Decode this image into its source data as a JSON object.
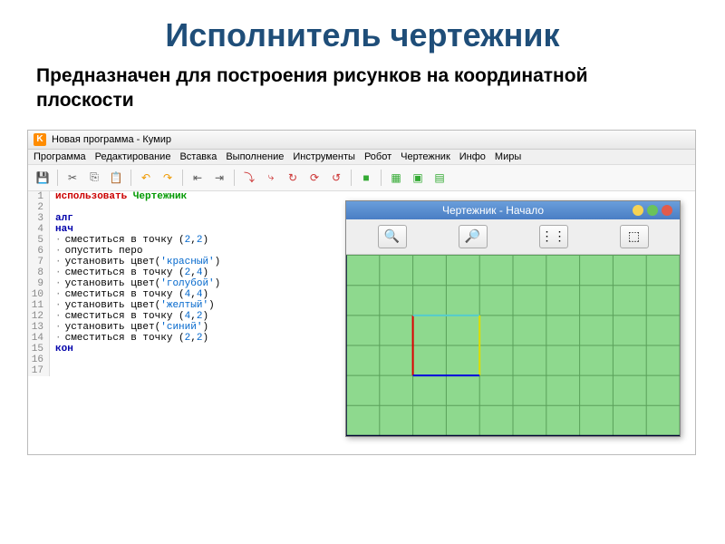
{
  "slide": {
    "title": "Исполнитель чертежник",
    "subtitle": "Предназначен для построения рисунков на координатной плоскости"
  },
  "app": {
    "title": "Новая программа - Кумир",
    "menu": [
      "Программа",
      "Редактирование",
      "Вставка",
      "Выполнение",
      "Инструменты",
      "Робот",
      "Чертежник",
      "Инфо",
      "Миры"
    ]
  },
  "code": {
    "lines": [
      {
        "n": "1",
        "html": "<span class='kw-use'>использовать</span> <span class='kw-module'>Чертежник</span>"
      },
      {
        "n": "2",
        "html": ""
      },
      {
        "n": "3",
        "html": "<span class='kw-alg'>алг</span>"
      },
      {
        "n": "4",
        "html": "<span class='kw-alg'>нач</span>"
      },
      {
        "n": "5",
        "html": "<span class='bullet'>·</span><span class='kw-cmd'>сместиться в точку </span>(<span class='kw-num'>2</span>,<span class='kw-num'>2</span>)"
      },
      {
        "n": "6",
        "html": "<span class='bullet'>·</span><span class='kw-cmd'>опустить перо</span>"
      },
      {
        "n": "7",
        "html": "<span class='bullet'>·</span><span class='kw-cmd'>установить цвет</span>(<span class='kw-str'>'красный'</span>)"
      },
      {
        "n": "8",
        "html": "<span class='bullet'>·</span><span class='kw-cmd'>сместиться в точку </span>(<span class='kw-num'>2</span>,<span class='kw-num'>4</span>)"
      },
      {
        "n": "9",
        "html": "<span class='bullet'>·</span><span class='kw-cmd'>установить цвет</span>(<span class='kw-str'>'голубой'</span>)"
      },
      {
        "n": "10",
        "html": "<span class='bullet'>·</span><span class='kw-cmd'>сместиться в точку </span>(<span class='kw-num'>4</span>,<span class='kw-num'>4</span>)"
      },
      {
        "n": "11",
        "html": "<span class='bullet'>·</span><span class='kw-cmd'>установить цвет</span>(<span class='kw-str'>'желтый'</span>)"
      },
      {
        "n": "12",
        "html": "<span class='bullet'>·</span><span class='kw-cmd'>сместиться в точку </span>(<span class='kw-num'>4</span>,<span class='kw-num'>2</span>)"
      },
      {
        "n": "13",
        "html": "<span class='bullet'>·</span><span class='kw-cmd'>установить цвет</span>(<span class='kw-str'>'синий'</span>)"
      },
      {
        "n": "14",
        "html": "<span class='bullet'>·</span><span class='kw-cmd'>сместиться в точку </span>(<span class='kw-num'>2</span>,<span class='kw-num'>2</span>)"
      },
      {
        "n": "15",
        "html": "<span class='kw-alg'>кон</span>"
      },
      {
        "n": "16",
        "html": ""
      },
      {
        "n": "17",
        "html": ""
      }
    ]
  },
  "canvas": {
    "title": "Чертежник - Начало",
    "tools": {
      "zoom_in": "🔍+",
      "zoom_out": "🔍-",
      "grid": "⋮⋮⋮",
      "fit": "⬚"
    }
  },
  "chart_data": {
    "type": "line",
    "title": "Чертежник canvas drawing",
    "xlim": [
      0,
      10
    ],
    "ylim": [
      0,
      6
    ],
    "grid": true,
    "series": [
      {
        "name": "красный",
        "color": "#d00",
        "points": [
          [
            2,
            2
          ],
          [
            2,
            4
          ]
        ]
      },
      {
        "name": "голубой",
        "color": "#5cc",
        "points": [
          [
            2,
            4
          ],
          [
            4,
            4
          ]
        ]
      },
      {
        "name": "желтый",
        "color": "#dd0",
        "points": [
          [
            4,
            4
          ],
          [
            4,
            2
          ]
        ]
      },
      {
        "name": "синий",
        "color": "#00d",
        "points": [
          [
            4,
            2
          ],
          [
            2,
            2
          ]
        ]
      }
    ]
  },
  "toolbar_icons": [
    "save-icon",
    "cut-icon",
    "copy-icon",
    "paste-icon",
    "undo-icon",
    "redo-icon",
    "indent-icon",
    "outdent-icon",
    "step-icon",
    "step-over-icon",
    "run-icon",
    "stop-icon",
    "reset-icon",
    "grid1-icon",
    "grid2-icon",
    "grid3-icon"
  ]
}
